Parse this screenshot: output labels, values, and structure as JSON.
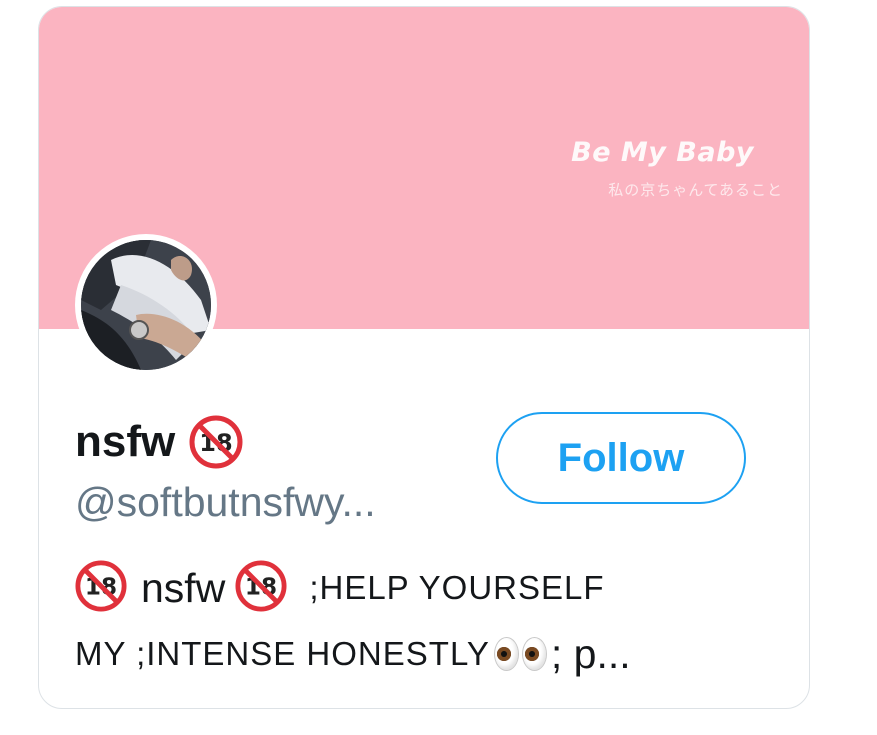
{
  "banner": {
    "title": "Be My Baby",
    "subtitle": "私の京ちゃんてあること",
    "background_color": "#fbb4c1"
  },
  "profile": {
    "name": "nsfw",
    "name_badge_icon": "no-one-under-18-icon",
    "handle": "@softbutnsfwy...",
    "avatar_icon": "profile-photo"
  },
  "follow_button": {
    "label": "Follow",
    "accent_color": "#1da1f2"
  },
  "bio": {
    "line1": {
      "word": "nsfw",
      "caps": ";HELP YOURSELF"
    },
    "line2": {
      "caps": "MY ;INTENSE HONESTLY",
      "eyes_icon": "eyes-icon",
      "tail": "; p..."
    }
  }
}
